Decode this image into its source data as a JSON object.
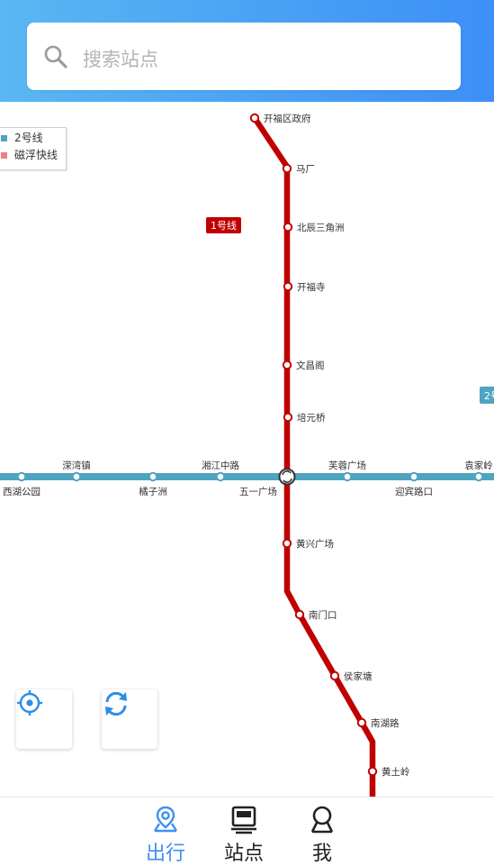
{
  "search": {
    "placeholder": "搜索站点"
  },
  "legend": [
    {
      "label": "2号线",
      "color": "#4fa4c0"
    },
    {
      "label": "磁浮快线",
      "color": "#f08080"
    }
  ],
  "line1": {
    "badge": "1号线",
    "color": "#c00000",
    "stations": [
      "开福区政府",
      "马厂",
      "北辰三角洲",
      "开福寺",
      "文昌阁",
      "培元桥",
      "五一广场",
      "黄兴广场",
      "南门口",
      "侯家塘",
      "南湖路",
      "黄土岭"
    ]
  },
  "line2": {
    "badge": "2号",
    "color": "#4fa4c0",
    "stations": [
      "西湖公园",
      "溁湾镇",
      "橘子洲",
      "湘江中路",
      "五一广场",
      "芙蓉广场",
      "迎宾路口",
      "袁家岭"
    ]
  },
  "controls": {
    "locate_icon": "locate-icon",
    "refresh_icon": "refresh-icon"
  },
  "tabs": [
    {
      "label": "出行",
      "icon": "map-pin-icon",
      "active": true,
      "color": "#3f8ff0"
    },
    {
      "label": "站点",
      "icon": "train-icon",
      "active": false,
      "color": "#333333"
    },
    {
      "label": "我",
      "icon": "user-icon",
      "active": false,
      "color": "#333333"
    }
  ]
}
